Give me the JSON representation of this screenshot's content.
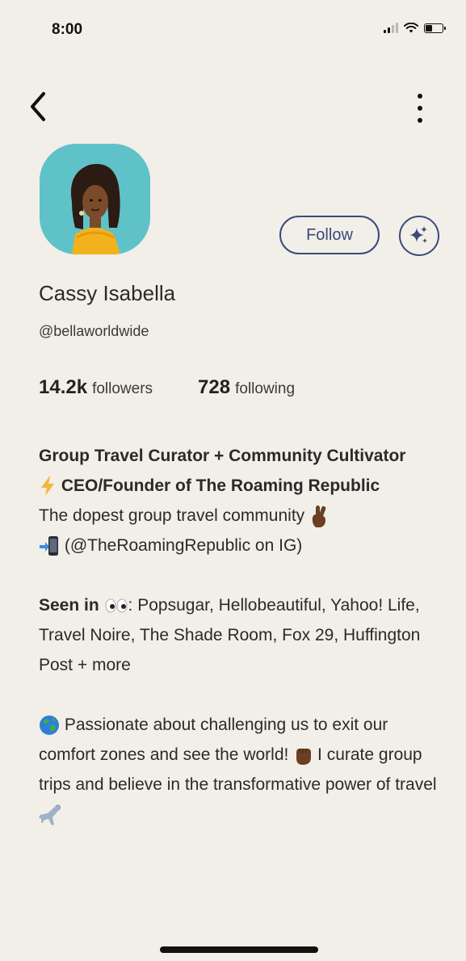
{
  "status_bar": {
    "time": "8:00",
    "battery_level": 0.4
  },
  "profile": {
    "name": "Cassy Isabella",
    "handle": "@bellaworldwide",
    "follow_label": "Follow",
    "followers_count": "14.2k",
    "followers_label": "followers",
    "following_count": "728",
    "following_label": "following"
  },
  "bio": {
    "line1": "Group Travel Curator + Community Cultivator",
    "line2": "CEO/Founder of The Roaming Republic",
    "line3": "The dopest group travel community",
    "line4": "(@TheRoamingRepublic on IG)",
    "seen_in_label": "Seen in",
    "seen_in_text": ": Popsugar, Hellobeautiful, Yahoo! Life, Travel Noire, The Shade Room, Fox 29, Huffington Post + more",
    "passion_text": "Passionate about challenging us to exit our comfort zones and see the world!",
    "curate_text": "I curate group trips and believe in the transformative power of travel"
  },
  "icons": {
    "back": "chevron-left-icon",
    "more": "more-vertical-icon",
    "sparkle": "sparkle-icon",
    "lightning": "lightning-icon",
    "hand": "fingers-crossed-icon",
    "phone": "phone-arrow-icon",
    "eyes": "eyes-icon",
    "globe": "globe-icon",
    "fist": "raised-fist-icon",
    "plane": "airplane-icon"
  },
  "colors": {
    "background": "#f1efe8",
    "accent": "#3a4a7a",
    "text": "#2a2a2a"
  }
}
